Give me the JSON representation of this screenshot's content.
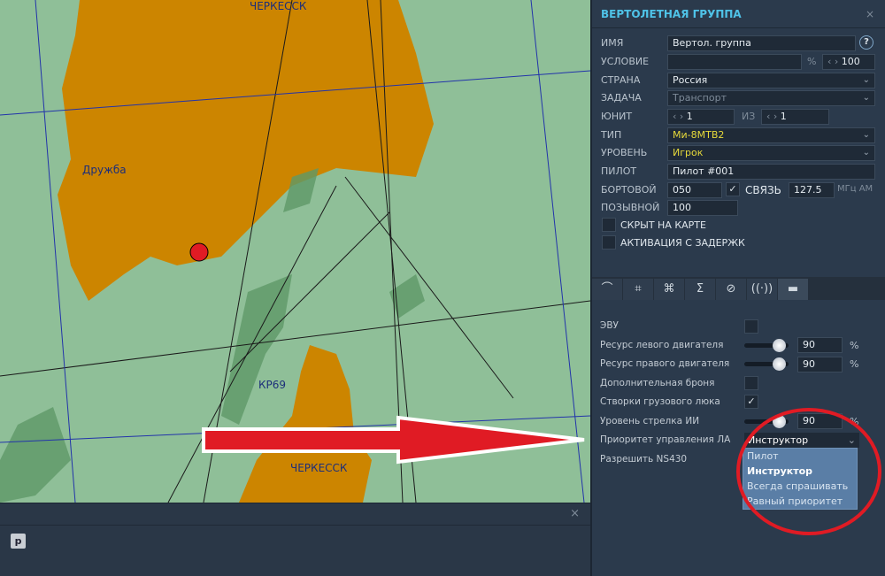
{
  "map": {
    "labels": {
      "top_city": "ЧЕРКЕССК",
      "druzhba": "Дружба",
      "kr69": "КР69",
      "bottom_city": "ЧЕРКЕССК"
    }
  },
  "bottom": {
    "p_button": "p",
    "close": "×"
  },
  "panel": {
    "title": "ВЕРТОЛЕТНАЯ ГРУППА",
    "close": "×",
    "name_label": "ИМЯ",
    "name_value": "Вертол. группа",
    "help": "?",
    "condition_label": "УСЛОВИЕ",
    "condition_value": "",
    "percent": "%",
    "condition_prob": "100",
    "country_label": "СТРАНА",
    "country_value": "Россия",
    "task_label": "ЗАДАЧА",
    "task_value": "Транспорт",
    "unit_label": "ЮНИТ",
    "unit_value": "1",
    "of_label": "ИЗ",
    "of_value": "1",
    "type_label": "ТИП",
    "type_value": "Ми-8МТВ2",
    "level_label": "УРОВЕНЬ",
    "level_value": "Игрок",
    "pilot_label": "ПИЛОТ",
    "pilot_value": "Пилот #001",
    "board_label": "БОРТОВОЙ",
    "board_value": "050",
    "comm_label": "СВЯЗЬ",
    "comm_checked": true,
    "freq_value": "127.5",
    "freq_unit": "МГц АМ",
    "callsign_label": "ПОЗЫВНОЙ",
    "callsign_value": "100",
    "hidden_label": "СКРЫТ НА КАРТЕ",
    "delay_label": "АКТИВАЦИЯ С ЗАДЕРЖК",
    "tabs": [
      "route",
      "target",
      "payload",
      "summary",
      "failures",
      "radio",
      "aircraft-settings"
    ],
    "options": {
      "evu": "ЭВУ",
      "left_engine": "Ресурс левого двигателя",
      "left_engine_value": "90",
      "right_engine": "Ресурс правого двигателя",
      "right_engine_value": "90",
      "armor": "Дополнительная броня",
      "cargo_doors": "Створки грузового люка",
      "ai_gunner": "Уровень стрелка ИИ",
      "ai_gunner_value": "90",
      "pct": "%",
      "control_priority": "Приоритет управления ЛА",
      "control_priority_value": "Инструктор",
      "ns430": "Разрешить NS430",
      "dropdown": [
        "Пилот",
        "Инструктор",
        "Всегда спрашивать",
        "Равный приоритет"
      ]
    }
  },
  "colors": {
    "title": "#4fc3e8",
    "highlight": "#e6d93a",
    "annotation": "#e01b24"
  }
}
